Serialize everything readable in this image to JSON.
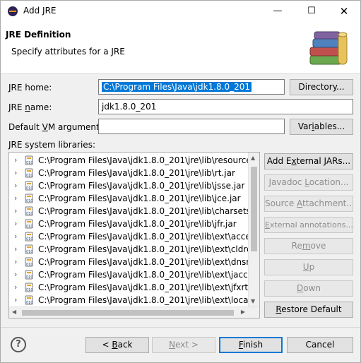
{
  "window": {
    "title": "Add JRE",
    "min_glyph": "—",
    "max_glyph": "☐",
    "close_glyph": "✕"
  },
  "header": {
    "title": "JRE Definition",
    "description": "Specify attributes for a JRE"
  },
  "form": {
    "jre_home_label_pre": "",
    "jre_home_label_u": "J",
    "jre_home_label_post": "RE home:",
    "jre_home_value": "C:\\Program Files\\Java\\jdk1.8.0_201",
    "directory_button_pre": "Director",
    "directory_button_u": "y",
    "directory_button_post": "...",
    "jre_name_label_pre": "JRE ",
    "jre_name_label_u": "n",
    "jre_name_label_post": "ame:",
    "jre_name_value": "jdk1.8.0_201",
    "vm_args_label_pre": "Default ",
    "vm_args_label_u": "V",
    "vm_args_label_post": "M arguments:",
    "vm_args_value": "",
    "variables_button_pre": "Var",
    "variables_button_u": "i",
    "variables_button_post": "ables...",
    "libraries_label": "JRE system libraries:"
  },
  "libraries": [
    "C:\\Program Files\\Java\\jdk1.8.0_201\\jre\\lib\\resources.jar",
    "C:\\Program Files\\Java\\jdk1.8.0_201\\jre\\lib\\rt.jar",
    "C:\\Program Files\\Java\\jdk1.8.0_201\\jre\\lib\\jsse.jar",
    "C:\\Program Files\\Java\\jdk1.8.0_201\\jre\\lib\\jce.jar",
    "C:\\Program Files\\Java\\jdk1.8.0_201\\jre\\lib\\charsets.jar",
    "C:\\Program Files\\Java\\jdk1.8.0_201\\jre\\lib\\jfr.jar",
    "C:\\Program Files\\Java\\jdk1.8.0_201\\jre\\lib\\ext\\access-br",
    "C:\\Program Files\\Java\\jdk1.8.0_201\\jre\\lib\\ext\\cldrdata.ja",
    "C:\\Program Files\\Java\\jdk1.8.0_201\\jre\\lib\\ext\\dnsns.jar",
    "C:\\Program Files\\Java\\jdk1.8.0_201\\jre\\lib\\ext\\jaccess.jar",
    "C:\\Program Files\\Java\\jdk1.8.0_201\\jre\\lib\\ext\\jfxrt.jar",
    "C:\\Program Files\\Java\\jdk1.8.0_201\\jre\\lib\\ext\\localedata"
  ],
  "side_buttons": {
    "add_external_pre": "Add E",
    "add_external_u": "x",
    "add_external_post": "ternal JARs...",
    "javadoc_pre": "Javadoc ",
    "javadoc_u": "L",
    "javadoc_post": "ocation...",
    "source_pre": "Source ",
    "source_u": "A",
    "source_post": "ttachment...",
    "external_ann_pre": "",
    "external_ann_u": "E",
    "external_ann_post": "xternal annotations...",
    "remove_pre": "Re",
    "remove_u": "m",
    "remove_post": "ove",
    "up_pre": "",
    "up_u": "U",
    "up_post": "p",
    "down_pre": "",
    "down_u": "D",
    "down_post": "own",
    "restore_pre": "",
    "restore_u": "R",
    "restore_post": "estore Default"
  },
  "footer": {
    "help_glyph": "?",
    "back_pre": "< ",
    "back_u": "B",
    "back_post": "ack",
    "next_pre": "",
    "next_u": "N",
    "next_post": "ext >",
    "finish_pre": "",
    "finish_u": "F",
    "finish_post": "inish",
    "cancel": "Cancel"
  }
}
